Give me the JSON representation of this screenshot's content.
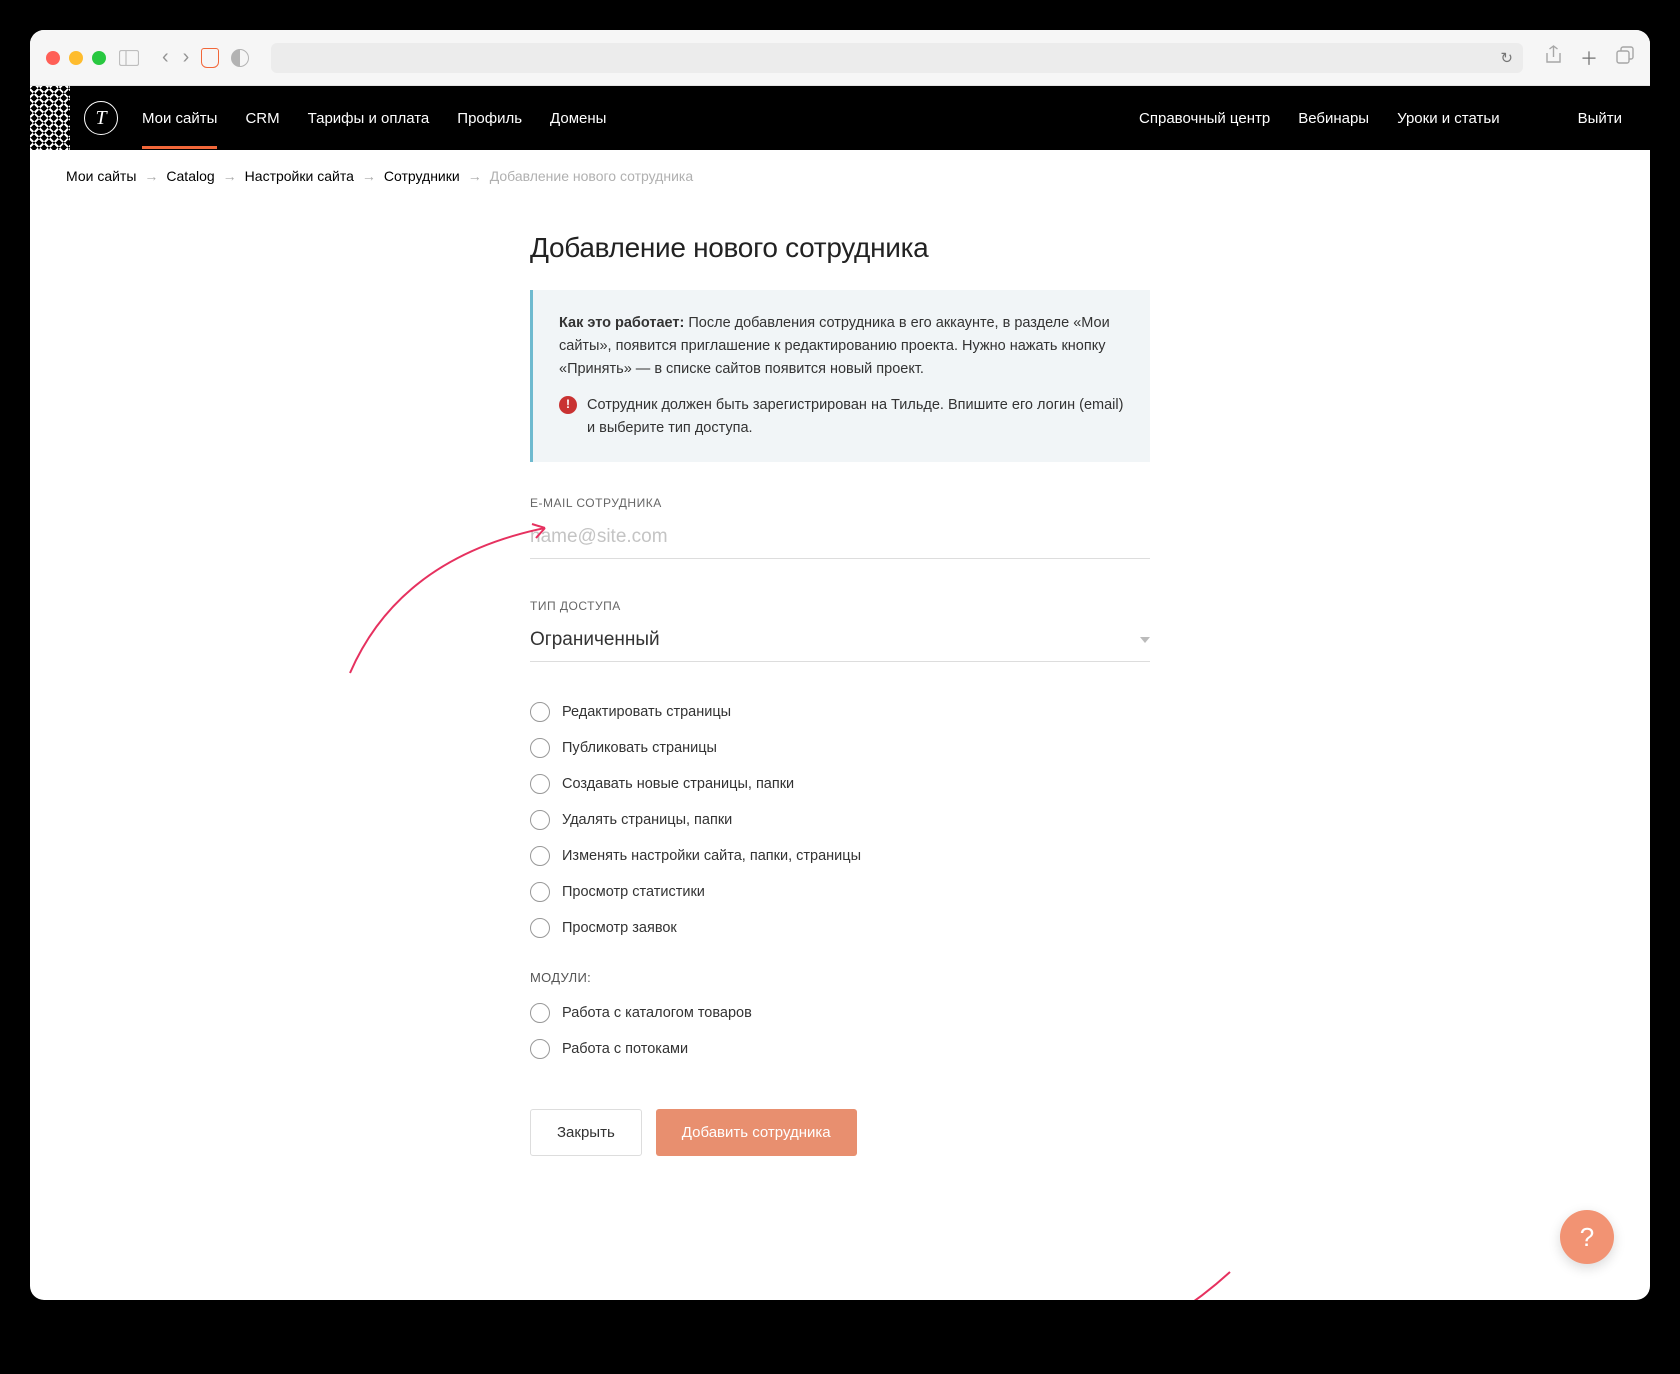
{
  "nav": {
    "items": [
      "Мои сайты",
      "CRM",
      "Тарифы и оплата",
      "Профиль",
      "Домены"
    ],
    "right": [
      "Справочный центр",
      "Вебинары",
      "Уроки и статьи"
    ],
    "logout": "Выйти"
  },
  "breadcrumb": {
    "items": [
      "Мои сайты",
      "Catalog",
      "Настройки сайта",
      "Сотрудники"
    ],
    "current": "Добавление нового сотрудника"
  },
  "page": {
    "title": "Добавление нового сотрудника",
    "info_strong": "Как это работает:",
    "info_text": " После добавления сотрудника в его аккаунте, в разделе «Мои сайты», появится приглашение к редактированию проекта. Нужно нажать кнопку «Принять» — в списке сайтов появится новый проект.",
    "warning_text": "Сотрудник должен быть зарегистрирован на Тильде. Впишите его логин (email) и выберите тип доступа."
  },
  "fields": {
    "email_label": "E-MAIL СОТРУДНИКА",
    "email_placeholder": "name@site.com",
    "access_label": "ТИП ДОСТУПА",
    "access_value": "Ограниченный"
  },
  "permissions": [
    "Редактировать страницы",
    "Публиковать страницы",
    "Создавать новые страницы, папки",
    "Удалять страницы, папки",
    "Изменять настройки сайта, папки, страницы",
    "Просмотр статистики",
    "Просмотр заявок"
  ],
  "modules": {
    "label": "МОДУЛИ:",
    "items": [
      "Работа с каталогом товаров",
      "Работа с потоками"
    ]
  },
  "buttons": {
    "close": "Закрыть",
    "submit": "Добавить сотрудника"
  },
  "help": "?"
}
